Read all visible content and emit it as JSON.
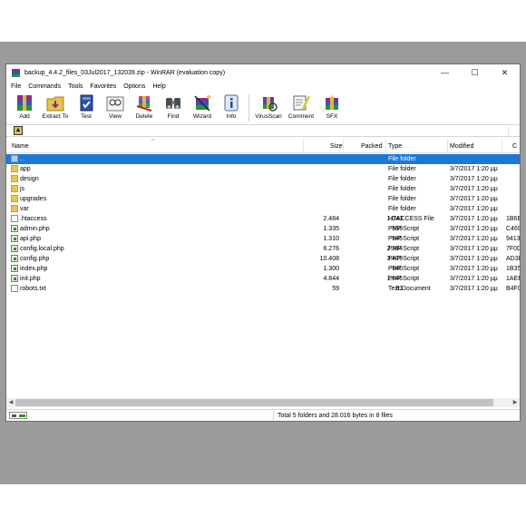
{
  "window": {
    "title": "backup_4.4.2_files_03Jul2017_132039.zip - WinRAR (evaluation copy)",
    "minimize": "—",
    "maximize": "☐",
    "close": "✕"
  },
  "menu": [
    "File",
    "Commands",
    "Tools",
    "Favorites",
    "Options",
    "Help"
  ],
  "toolbar": [
    {
      "label": "Add",
      "icon": "add-archive-icon"
    },
    {
      "label": "Extract To",
      "icon": "extract-icon"
    },
    {
      "label": "Test",
      "icon": "test-icon"
    },
    {
      "label": "View",
      "icon": "view-icon"
    },
    {
      "label": "Delete",
      "icon": "delete-icon"
    },
    {
      "label": "Find",
      "icon": "find-icon"
    },
    {
      "label": "Wizard",
      "icon": "wizard-icon"
    },
    {
      "label": "Info",
      "icon": "info-icon"
    },
    {
      "label": "VirusScan",
      "icon": "virusscan-icon"
    },
    {
      "label": "Comment",
      "icon": "comment-icon"
    },
    {
      "label": "SFX",
      "icon": "sfx-icon"
    }
  ],
  "columns": {
    "name": "Name",
    "size": "Size",
    "packed": "Packed",
    "type": "Type",
    "modified": "Modified",
    "crc": "C"
  },
  "rows": [
    {
      "name": "..",
      "size": "",
      "packed": "",
      "type": "File folder",
      "modified": "",
      "crc": "",
      "kind": "up",
      "selected": true
    },
    {
      "name": "app",
      "size": "",
      "packed": "",
      "type": "File folder",
      "modified": "3/7/2017 1:20 μμ",
      "crc": "",
      "kind": "folder"
    },
    {
      "name": "design",
      "size": "",
      "packed": "",
      "type": "File folder",
      "modified": "3/7/2017 1:20 μμ",
      "crc": "",
      "kind": "folder"
    },
    {
      "name": "js",
      "size": "",
      "packed": "",
      "type": "File folder",
      "modified": "3/7/2017 1:20 μμ",
      "crc": "",
      "kind": "folder"
    },
    {
      "name": "upgrades",
      "size": "",
      "packed": "",
      "type": "File folder",
      "modified": "3/7/2017 1:20 μμ",
      "crc": "",
      "kind": "folder"
    },
    {
      "name": "var",
      "size": "",
      "packed": "",
      "type": "File folder",
      "modified": "3/7/2017 1:20 μμ",
      "crc": "",
      "kind": "folder"
    },
    {
      "name": ".htaccess",
      "size": "2.484",
      "packed": "1.043",
      "type": "HTACCESS File",
      "modified": "3/7/2017 1:20 μμ",
      "crc": "1B6E",
      "kind": "file"
    },
    {
      "name": "admin.php",
      "size": "1.335",
      "packed": "559",
      "type": "PHP Script",
      "modified": "3/7/2017 1:20 μμ",
      "crc": "C469",
      "kind": "php"
    },
    {
      "name": "api.php",
      "size": "1.310",
      "packed": "545",
      "type": "PHP Script",
      "modified": "3/7/2017 1:20 μμ",
      "crc": "9413",
      "kind": "php"
    },
    {
      "name": "config.local.php",
      "size": "6.276",
      "packed": "2.384",
      "type": "PHP Script",
      "modified": "3/7/2017 1:20 μμ",
      "crc": "7F0D",
      "kind": "php"
    },
    {
      "name": "config.php",
      "size": "10.408",
      "packed": "3.479",
      "type": "PHP Script",
      "modified": "3/7/2017 1:20 μμ",
      "crc": "AD3D",
      "kind": "php"
    },
    {
      "name": "index.php",
      "size": "1.300",
      "packed": "540",
      "type": "PHP Script",
      "modified": "3/7/2017 1:20 μμ",
      "crc": "1B35",
      "kind": "php"
    },
    {
      "name": "init.php",
      "size": "4.844",
      "packed": "1.646",
      "type": "PHP Script",
      "modified": "3/7/2017 1:20 μμ",
      "crc": "1AEE",
      "kind": "php"
    },
    {
      "name": "robots.txt",
      "size": "59",
      "packed": "51",
      "type": "Text Document",
      "modified": "3/7/2017 1:20 μμ",
      "crc": "B4F0",
      "kind": "file"
    }
  ],
  "status": {
    "text": "Total 5 folders and 28.016 bytes in 8 files"
  },
  "colors": {
    "selection": "#1e78d6",
    "folder": "#e9c552",
    "background_band": "#9b9b9b"
  }
}
